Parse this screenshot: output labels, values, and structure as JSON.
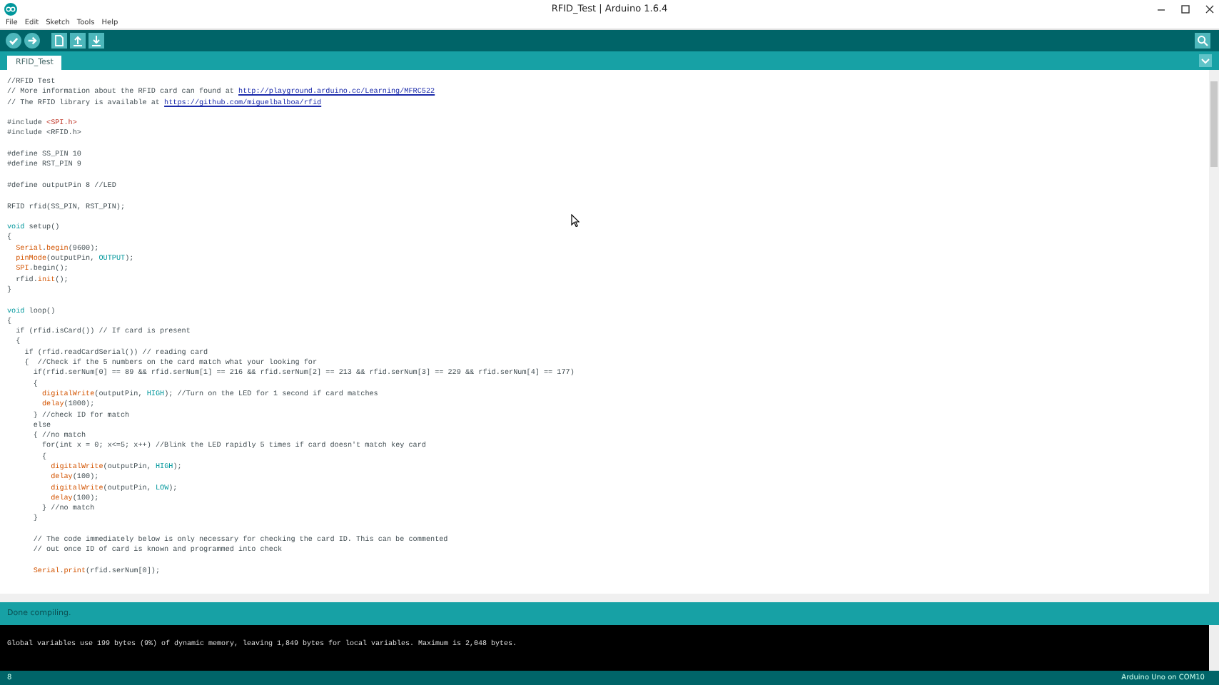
{
  "window": {
    "title": "RFID_Test | Arduino 1.6.4"
  },
  "menu": [
    "File",
    "Edit",
    "Sketch",
    "Tools",
    "Help"
  ],
  "toolbar": [
    {
      "kind": "verify"
    },
    {
      "kind": "upload"
    },
    {
      "kind": "new"
    },
    {
      "kind": "open"
    },
    {
      "kind": "save"
    }
  ],
  "tabs": [
    {
      "label": "RFID_Test",
      "selected": true
    }
  ],
  "code": [
    [
      [
        {
          "t": "//RFID Test",
          "kind": "plain"
        }
      ],
      [
        {
          "t": "// More information about the RFID card can found at ",
          "kind": "plain"
        },
        {
          "t": "http://playground.arduino.cc/Learning/MFRC522",
          "kind": "link"
        }
      ],
      [
        {
          "t": "// The RFID library is available at ",
          "kind": "plain"
        },
        {
          "t": "https://github.com/miguelbalboa/rfid",
          "kind": "link"
        }
      ]
    ],
    [
      [
        {
          "t": "#include ",
          "kind": "plain"
        },
        {
          "t": "<SPI.h>",
          "kind": "str"
        }
      ],
      [
        {
          "t": "#include <RFID.h>",
          "kind": "plain"
        }
      ]
    ],
    [
      [
        {
          "t": "#define SS_PIN 10",
          "kind": "plain"
        }
      ],
      [
        {
          "t": "#define RST_PIN 9",
          "kind": "plain"
        }
      ]
    ],
    [
      [
        {
          "t": "#define outputPin 8 //LED",
          "kind": "plain"
        }
      ]
    ],
    [
      [
        {
          "t": "RFID rfid(SS_PIN, RST_PIN);",
          "kind": "plain"
        }
      ]
    ],
    [
      [
        {
          "t": "void",
          "kind": "type"
        },
        {
          "t": " setup()",
          "kind": "plain"
        }
      ],
      [
        {
          "t": "{",
          "kind": "plain"
        }
      ],
      [
        {
          "t": "  Serial",
          "kind": "fn"
        },
        {
          "t": ".",
          "kind": "plain"
        },
        {
          "t": "begin",
          "kind": "fn"
        },
        {
          "t": "(9600);",
          "kind": "plain"
        }
      ],
      [
        {
          "t": "  pinMode",
          "kind": "fn"
        },
        {
          "t": "(outputPin, ",
          "kind": "plain"
        },
        {
          "t": "OUTPUT",
          "kind": "const"
        },
        {
          "t": ");",
          "kind": "plain"
        }
      ],
      [
        {
          "t": "  SPI",
          "kind": "fn"
        },
        {
          "t": ".begin();",
          "kind": "plain"
        }
      ],
      [
        {
          "t": "  rfid.",
          "kind": "plain"
        },
        {
          "t": "init",
          "kind": "fn"
        },
        {
          "t": "();",
          "kind": "plain"
        }
      ],
      [
        {
          "t": "}",
          "kind": "plain"
        }
      ]
    ],
    [
      [
        {
          "t": "void",
          "kind": "type"
        },
        {
          "t": " loop()",
          "kind": "plain"
        }
      ],
      [
        {
          "t": "{",
          "kind": "plain"
        }
      ],
      [
        {
          "t": "  if (rfid.isCard()) // If card is present",
          "kind": "plain"
        }
      ],
      [
        {
          "t": "  {",
          "kind": "plain"
        }
      ],
      [
        {
          "t": "    if (rfid.readCardSerial()) // reading card",
          "kind": "plain"
        }
      ],
      [
        {
          "t": "    {  //Check if the 5 numbers on the card match what your looking for",
          "kind": "plain"
        }
      ],
      [
        {
          "t": "      if(rfid.serNum[0] == 89 && rfid.serNum[1] == 216 && rfid.serNum[2] == 213 && rfid.serNum[3] == 229 && rfid.serNum[4] == 177)",
          "kind": "plain"
        }
      ],
      [
        {
          "t": "      {",
          "kind": "plain"
        }
      ],
      [
        {
          "t": "        digitalWrite",
          "kind": "fn"
        },
        {
          "t": "(outputPin, ",
          "kind": "plain"
        },
        {
          "t": "HIGH",
          "kind": "const"
        },
        {
          "t": "); //Turn on the LED for 1 second if card matches",
          "kind": "plain"
        }
      ],
      [
        {
          "t": "        delay",
          "kind": "fn"
        },
        {
          "t": "(1000);",
          "kind": "plain"
        }
      ],
      [
        {
          "t": "      } //check ID for match",
          "kind": "plain"
        }
      ],
      [
        {
          "t": "      else",
          "kind": "plain"
        }
      ],
      [
        {
          "t": "      { //no match",
          "kind": "plain"
        }
      ],
      [
        {
          "t": "        for(int x = 0; x<=5; x++) //Blink the LED rapidly 5 times if card doesn't match key card",
          "kind": "plain"
        }
      ],
      [
        {
          "t": "        {",
          "kind": "plain"
        }
      ],
      [
        {
          "t": "          digitalWrite",
          "kind": "fn"
        },
        {
          "t": "(outputPin, ",
          "kind": "plain"
        },
        {
          "t": "HIGH",
          "kind": "const"
        },
        {
          "t": ");",
          "kind": "plain"
        }
      ],
      [
        {
          "t": "          delay",
          "kind": "fn"
        },
        {
          "t": "(100);",
          "kind": "plain"
        }
      ],
      [
        {
          "t": "          digitalWrite",
          "kind": "fn"
        },
        {
          "t": "(outputPin, ",
          "kind": "plain"
        },
        {
          "t": "LOW",
          "kind": "const"
        },
        {
          "t": ");",
          "kind": "plain"
        }
      ],
      [
        {
          "t": "          delay",
          "kind": "fn"
        },
        {
          "t": "(100);",
          "kind": "plain"
        }
      ],
      [
        {
          "t": "        } //no match",
          "kind": "plain"
        }
      ],
      [
        {
          "t": "      }",
          "kind": "plain"
        }
      ]
    ],
    [
      [
        {
          "t": "      // The code immediately below is only necessary for checking the card ID. This can be commented",
          "kind": "plain"
        }
      ],
      [
        {
          "t": "      // out once ID of card is known and programmed into check",
          "kind": "plain"
        }
      ]
    ],
    [
      [
        {
          "t": "      Serial",
          "kind": "fn"
        },
        {
          "t": ".",
          "kind": "plain"
        },
        {
          "t": "print",
          "kind": "fn"
        },
        {
          "t": "(rfid.serNum[0]);",
          "kind": "plain"
        }
      ]
    ]
  ],
  "status": "Done compiling.",
  "console": [
    "Global variables use 199 bytes (9%) of dynamic memory, leaving 1,849 bytes for local variables. Maximum is 2,048 bytes."
  ],
  "footer": {
    "line": "8",
    "board": "Arduino Uno on COM10"
  }
}
